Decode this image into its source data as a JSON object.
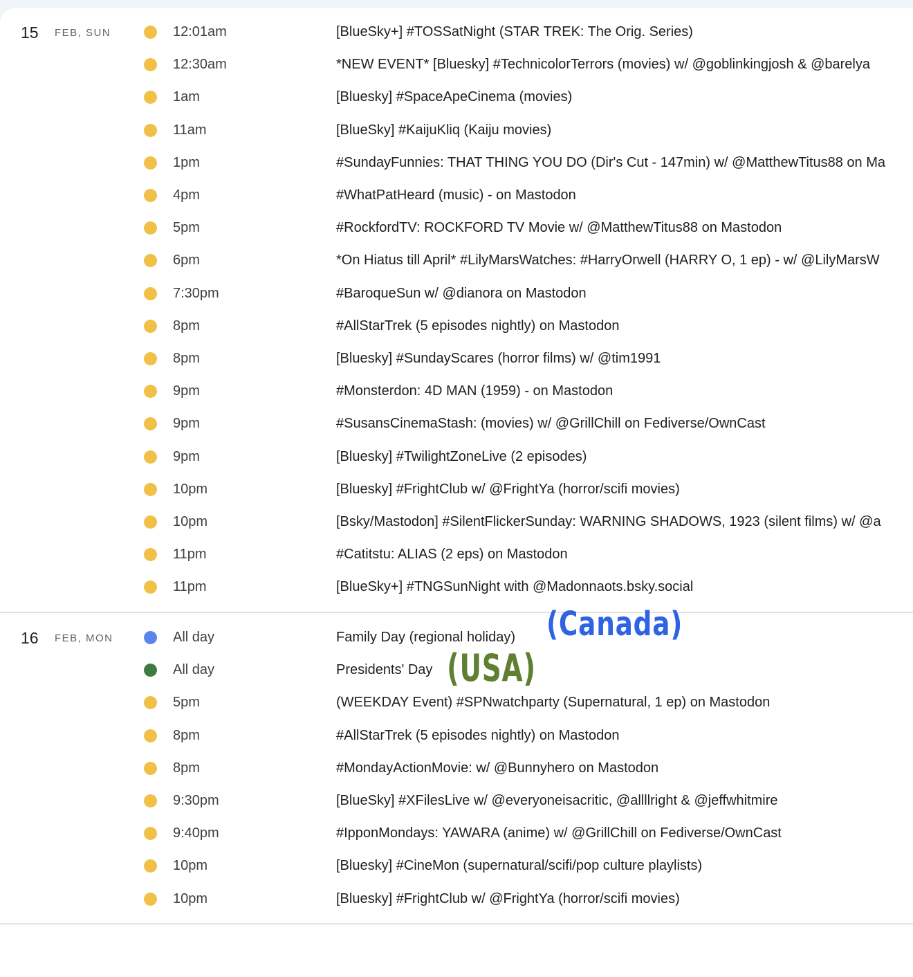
{
  "colors": {
    "event": "#f0c047",
    "holiday_canada": "#5a86eb",
    "holiday_usa": "#3f7b3f",
    "note_canada": "#2f63e6",
    "note_usa": "#5f7f32"
  },
  "days": [
    {
      "num": "15",
      "label": "FEB, SUN",
      "events": [
        {
          "time": "12:01am",
          "title": "[BlueSky+] #TOSSatNight (STAR TREK: The Orig. Series)",
          "color": "event"
        },
        {
          "time": "12:30am",
          "title": "*NEW EVENT* [Bluesky] #TechnicolorTerrors (movies) w/ @goblinkingjosh & @barelya",
          "color": "event"
        },
        {
          "time": "1am",
          "title": "[Bluesky] #SpaceApeCinema (movies)",
          "color": "event"
        },
        {
          "time": "11am",
          "title": "[BlueSky] #KaijuKliq (Kaiju movies)",
          "color": "event"
        },
        {
          "time": "1pm",
          "title": "#SundayFunnies: THAT THING YOU DO (Dir's Cut - 147min) w/ @MatthewTitus88 on Ma",
          "color": "event"
        },
        {
          "time": "4pm",
          "title": "#WhatPatHeard (music) - on Mastodon",
          "color": "event"
        },
        {
          "time": "5pm",
          "title": "#RockfordTV: ROCKFORD TV Movie w/ @MatthewTitus88 on Mastodon",
          "color": "event"
        },
        {
          "time": "6pm",
          "title": "*On Hiatus till April* #LilyMarsWatches: #HarryOrwell (HARRY O, 1 ep) - w/ @LilyMarsW",
          "color": "event"
        },
        {
          "time": "7:30pm",
          "title": "#BaroqueSun w/ @dianora on Mastodon",
          "color": "event"
        },
        {
          "time": "8pm",
          "title": "#AllStarTrek (5 episodes nightly) on Mastodon",
          "color": "event"
        },
        {
          "time": "8pm",
          "title": "[Bluesky] #SundayScares (horror films) w/ @tim1991",
          "color": "event"
        },
        {
          "time": "9pm",
          "title": "#Monsterdon: 4D MAN (1959) - on Mastodon",
          "color": "event"
        },
        {
          "time": "9pm",
          "title": "#SusansCinemaStash: (movies) w/ @GrillChill on Fediverse/OwnCast",
          "color": "event"
        },
        {
          "time": "9pm",
          "title": "[Bluesky] #TwilightZoneLive (2 episodes)",
          "color": "event"
        },
        {
          "time": "10pm",
          "title": "[Bluesky] #FrightClub w/ @FrightYa (horror/scifi movies)",
          "color": "event"
        },
        {
          "time": "10pm",
          "title": "[Bsky/Mastodon] #SilentFlickerSunday: WARNING SHADOWS, 1923 (silent films) w/ @a",
          "color": "event"
        },
        {
          "time": "11pm",
          "title": "#Catitstu: ALIAS (2 eps) on Mastodon",
          "color": "event"
        },
        {
          "time": "11pm",
          "title": "[BlueSky+] #TNGSunNight with @Madonnaots.bsky.social",
          "color": "event"
        }
      ]
    },
    {
      "num": "16",
      "label": "FEB, MON",
      "events": [
        {
          "time": "All day",
          "title": "Family Day (regional holiday)",
          "color": "holiday_canada"
        },
        {
          "time": "All day",
          "title": "Presidents' Day",
          "color": "holiday_usa"
        },
        {
          "time": "5pm",
          "title": "(WEEKDAY Event) #SPNwatchparty (Supernatural, 1 ep) on Mastodon",
          "color": "event"
        },
        {
          "time": "8pm",
          "title": "#AllStarTrek (5 episodes nightly) on Mastodon",
          "color": "event"
        },
        {
          "time": "8pm",
          "title": "#MondayActionMovie: w/ @Bunnyhero on Mastodon",
          "color": "event"
        },
        {
          "time": "9:30pm",
          "title": "[BlueSky] #XFilesLive w/ @everyoneisacritic, @allllright & @jeffwhitmire",
          "color": "event"
        },
        {
          "time": "9:40pm",
          "title": "#IpponMondays: YAWARA (anime) w/ @GrillChill on Fediverse/OwnCast",
          "color": "event"
        },
        {
          "time": "10pm",
          "title": "[Bluesky] #CineMon (supernatural/scifi/pop culture playlists)",
          "color": "event"
        },
        {
          "time": "10pm",
          "title": "[Bluesky] #FrightClub w/ @FrightYa (horror/scifi movies)",
          "color": "event"
        }
      ]
    }
  ],
  "annotations": {
    "canada": "(Canada)",
    "usa": "(USA)"
  }
}
